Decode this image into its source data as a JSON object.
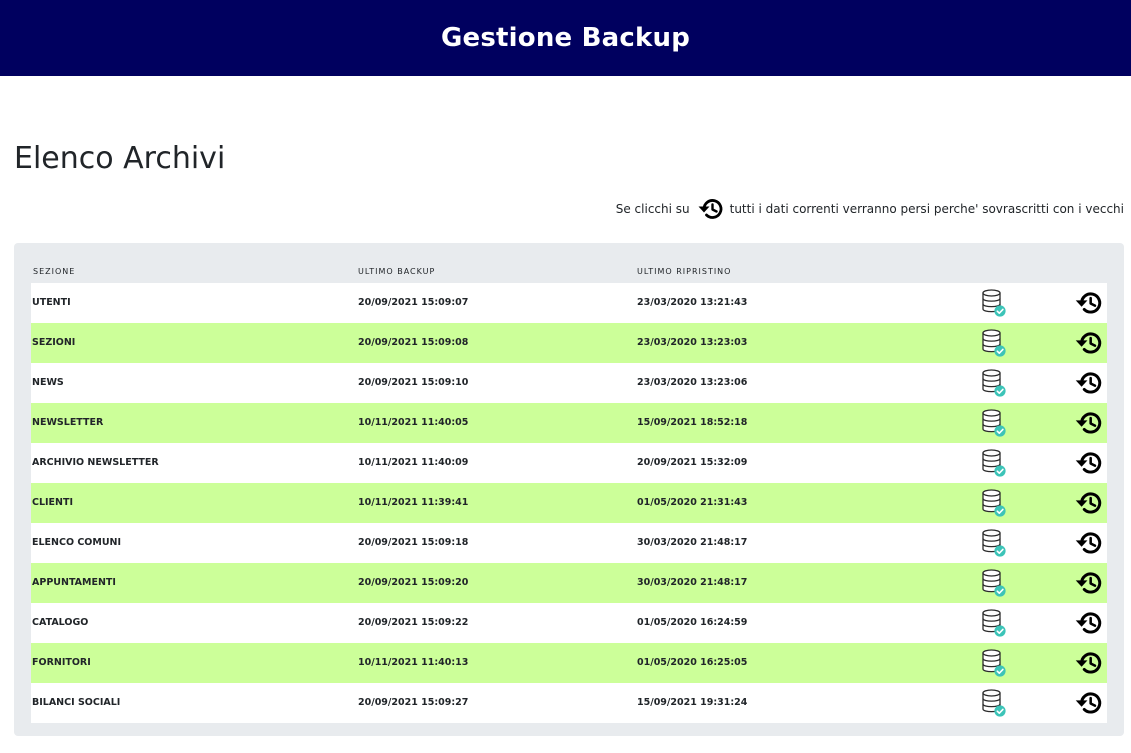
{
  "header": {
    "title": "Gestione Backup"
  },
  "page": {
    "title": "Elenco Archivi"
  },
  "notice": {
    "before": "Se clicchi su",
    "after": "tutti i dati correnti verranno persi perche' sovrascritti con i vecchi",
    "icon": "restore-history-icon"
  },
  "table": {
    "columns": {
      "section": "SEZIONE",
      "last_backup": "ULTIMO BACKUP",
      "last_restore": "ULTIMO RIPRISTINO"
    },
    "icons": {
      "backup": "database-check-icon",
      "restore": "restore-history-icon"
    },
    "row_colors": {
      "normal": "#ffffff",
      "alternate": "#ccff99"
    },
    "rows": [
      {
        "section": "UTENTI",
        "last_backup": "20/09/2021 15:09:07",
        "last_restore": "23/03/2020 13:21:43"
      },
      {
        "section": "SEZIONI",
        "last_backup": "20/09/2021 15:09:08",
        "last_restore": "23/03/2020 13:23:03"
      },
      {
        "section": "NEWS",
        "last_backup": "20/09/2021 15:09:10",
        "last_restore": "23/03/2020 13:23:06"
      },
      {
        "section": "NEWSLETTER",
        "last_backup": "10/11/2021 11:40:05",
        "last_restore": "15/09/2021 18:52:18"
      },
      {
        "section": "ARCHIVIO NEWSLETTER",
        "last_backup": "10/11/2021 11:40:09",
        "last_restore": "20/09/2021 15:32:09"
      },
      {
        "section": "CLIENTI",
        "last_backup": "10/11/2021 11:39:41",
        "last_restore": "01/05/2020 21:31:43"
      },
      {
        "section": "ELENCO COMUNI",
        "last_backup": "20/09/2021 15:09:18",
        "last_restore": "30/03/2020 21:48:17"
      },
      {
        "section": "APPUNTAMENTI",
        "last_backup": "20/09/2021 15:09:20",
        "last_restore": "30/03/2020 21:48:17"
      },
      {
        "section": "CATALOGO",
        "last_backup": "20/09/2021 15:09:22",
        "last_restore": "01/05/2020 16:24:59"
      },
      {
        "section": "FORNITORI",
        "last_backup": "10/11/2021 11:40:13",
        "last_restore": "01/05/2020 16:25:05"
      },
      {
        "section": "BILANCI SOCIALI",
        "last_backup": "20/09/2021 15:09:27",
        "last_restore": "15/09/2021 19:31:24"
      }
    ]
  }
}
